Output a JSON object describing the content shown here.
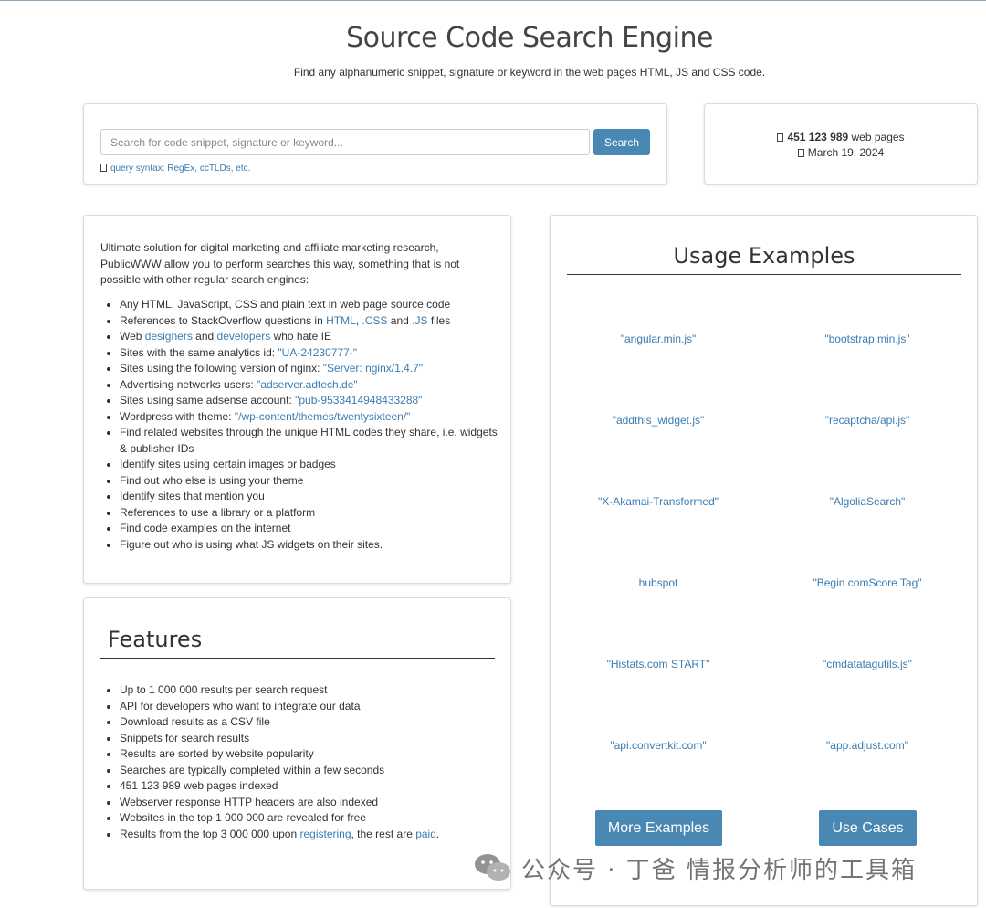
{
  "header": {
    "title": "Source Code Search Engine",
    "subtitle": "Find any alphanumeric snippet, signature or keyword in the web pages HTML, JS and CSS code."
  },
  "search": {
    "placeholder": "Search for code snippet, signature or keyword...",
    "value": "",
    "button_label": "Search",
    "syntax_link": "query syntax: RegEx, ccTLDs, etc."
  },
  "stats": {
    "pages_count": "451 123 989",
    "pages_suffix": " web pages",
    "date": "March 19, 2024"
  },
  "about": {
    "intro": "Ultimate solution for digital marketing and affiliate marketing research, PublicWWW allow you to perform searches this way, something that is not possible with other regular search engines:",
    "items": [
      [
        {
          "t": "Any HTML, JavaScript, CSS and plain text in web page source code"
        }
      ],
      [
        {
          "t": "References to StackOverflow questions in "
        },
        {
          "t": "HTML",
          "link": true
        },
        {
          "t": ", "
        },
        {
          "t": ".CSS",
          "link": true
        },
        {
          "t": " and "
        },
        {
          "t": ".JS",
          "link": true
        },
        {
          "t": " files"
        }
      ],
      [
        {
          "t": "Web "
        },
        {
          "t": "designers",
          "link": true
        },
        {
          "t": " and "
        },
        {
          "t": "developers",
          "link": true
        },
        {
          "t": " who hate IE"
        }
      ],
      [
        {
          "t": "Sites with the same analytics id: "
        },
        {
          "t": "\"UA-24230777-\"",
          "link": true
        }
      ],
      [
        {
          "t": "Sites using the following version of nginx: "
        },
        {
          "t": "\"Server: nginx/1.4.7\"",
          "link": true
        }
      ],
      [
        {
          "t": "Advertising networks users: "
        },
        {
          "t": "\"adserver.adtech.de\"",
          "link": true
        }
      ],
      [
        {
          "t": "Sites using same adsense account: "
        },
        {
          "t": "\"pub-9533414948433288\"",
          "link": true
        }
      ],
      [
        {
          "t": "Wordpress with theme: "
        },
        {
          "t": "\"/wp-content/themes/twentysixteen/\"",
          "link": true
        }
      ],
      [
        {
          "t": "Find related websites through the unique HTML codes they share, i.e. widgets & publisher IDs"
        }
      ],
      [
        {
          "t": "Identify sites using certain images or badges"
        }
      ],
      [
        {
          "t": "Find out who else is using your theme"
        }
      ],
      [
        {
          "t": "Identify sites that mention you"
        }
      ],
      [
        {
          "t": "References to use a library or a platform"
        }
      ],
      [
        {
          "t": "Find code examples on the internet"
        }
      ],
      [
        {
          "t": "Figure out who is using what JS widgets on their sites."
        }
      ]
    ]
  },
  "features": {
    "heading": "Features",
    "items": [
      [
        {
          "t": "Up to 1 000 000 results per search request"
        }
      ],
      [
        {
          "t": "API for developers who want to integrate our data"
        }
      ],
      [
        {
          "t": "Download results as a CSV file"
        }
      ],
      [
        {
          "t": "Snippets for search results"
        }
      ],
      [
        {
          "t": "Results are sorted by website popularity"
        }
      ],
      [
        {
          "t": "Searches are typically completed within a few seconds"
        }
      ],
      [
        {
          "t": "451 123 989 web pages indexed"
        }
      ],
      [
        {
          "t": "Webserver response HTTP headers are also indexed"
        }
      ],
      [
        {
          "t": "Websites in the top 1 000 000 are revealed for free"
        }
      ],
      [
        {
          "t": "Results from the top 3 000 000 upon "
        },
        {
          "t": "registering",
          "link": true
        },
        {
          "t": ", the rest are "
        },
        {
          "t": "paid",
          "link": true
        },
        {
          "t": "."
        }
      ]
    ]
  },
  "usage": {
    "heading": "Usage Examples",
    "examples": [
      "\"angular.min.js\"",
      "\"bootstrap.min.js\"",
      "\"addthis_widget.js\"",
      "\"recaptcha/api.js\"",
      "\"X-Akamai-Transformed\"",
      "\"AlgoliaSearch\"",
      "hubspot",
      "\"Begin comScore Tag\"",
      "\"Histats.com START\"",
      "\"cmdatatagutils.js\"",
      "\"api.convertkit.com\"",
      "\"app.adjust.com\""
    ],
    "more_button": "More Examples",
    "cases_button": "Use Cases"
  },
  "watermark": {
    "text": "公众号 · 丁爸 情报分析师的工具箱",
    "icon": "wechat-icon"
  },
  "colors": {
    "link": "#3a7cb3",
    "button": "#4a88b4"
  }
}
